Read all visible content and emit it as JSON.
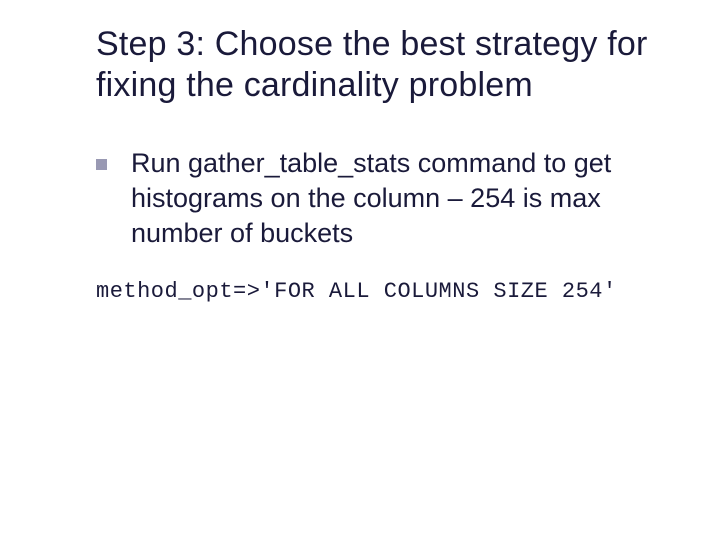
{
  "title": "Step 3:  Choose the best strategy for fixing the cardinality problem",
  "bullet1": "Run gather_table_stats command to get histograms on the column – 254 is max number of buckets",
  "code1": "method_opt=>'FOR ALL COLUMNS SIZE 254'"
}
